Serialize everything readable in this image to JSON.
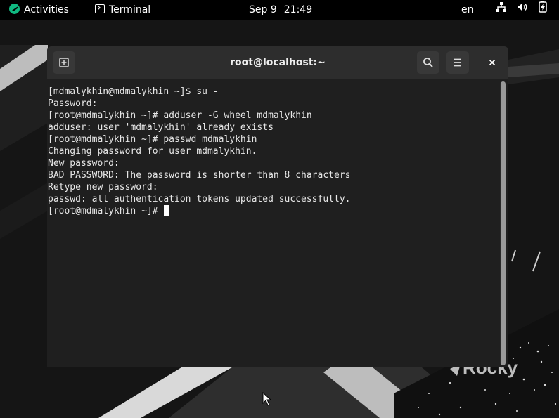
{
  "top_bar": {
    "activities_label": "Activities",
    "app_name": "Terminal",
    "date": "Sep 9",
    "time": "21:49",
    "input_language": "en",
    "tray_icons": [
      "network-icon",
      "volume-icon",
      "battery-icon"
    ]
  },
  "terminal_window": {
    "title": "root@localhost:~",
    "lines": [
      "[mdmalykhin@mdmalykhin ~]$ su -",
      "Password:",
      "[root@mdmalykhin ~]# adduser -G wheel mdmalykhin",
      "adduser: user 'mdmalykhin' already exists",
      "[root@mdmalykhin ~]# passwd mdmalykhin",
      "Changing password for user mdmalykhin.",
      "New password:",
      "BAD PASSWORD: The password is shorter than 8 characters",
      "Retype new password:",
      "passwd: all authentication tokens updated successfully.",
      "[root@mdmalykhin ~]# "
    ]
  },
  "wallpaper": {
    "brand_text": "Rocky"
  },
  "colors": {
    "top_bar_bg": "#000000",
    "terminal_bg": "#1f1f1f",
    "header_bg": "#2d2d2d",
    "text": "#e6e6e6",
    "rocky_green": "#10b981"
  }
}
